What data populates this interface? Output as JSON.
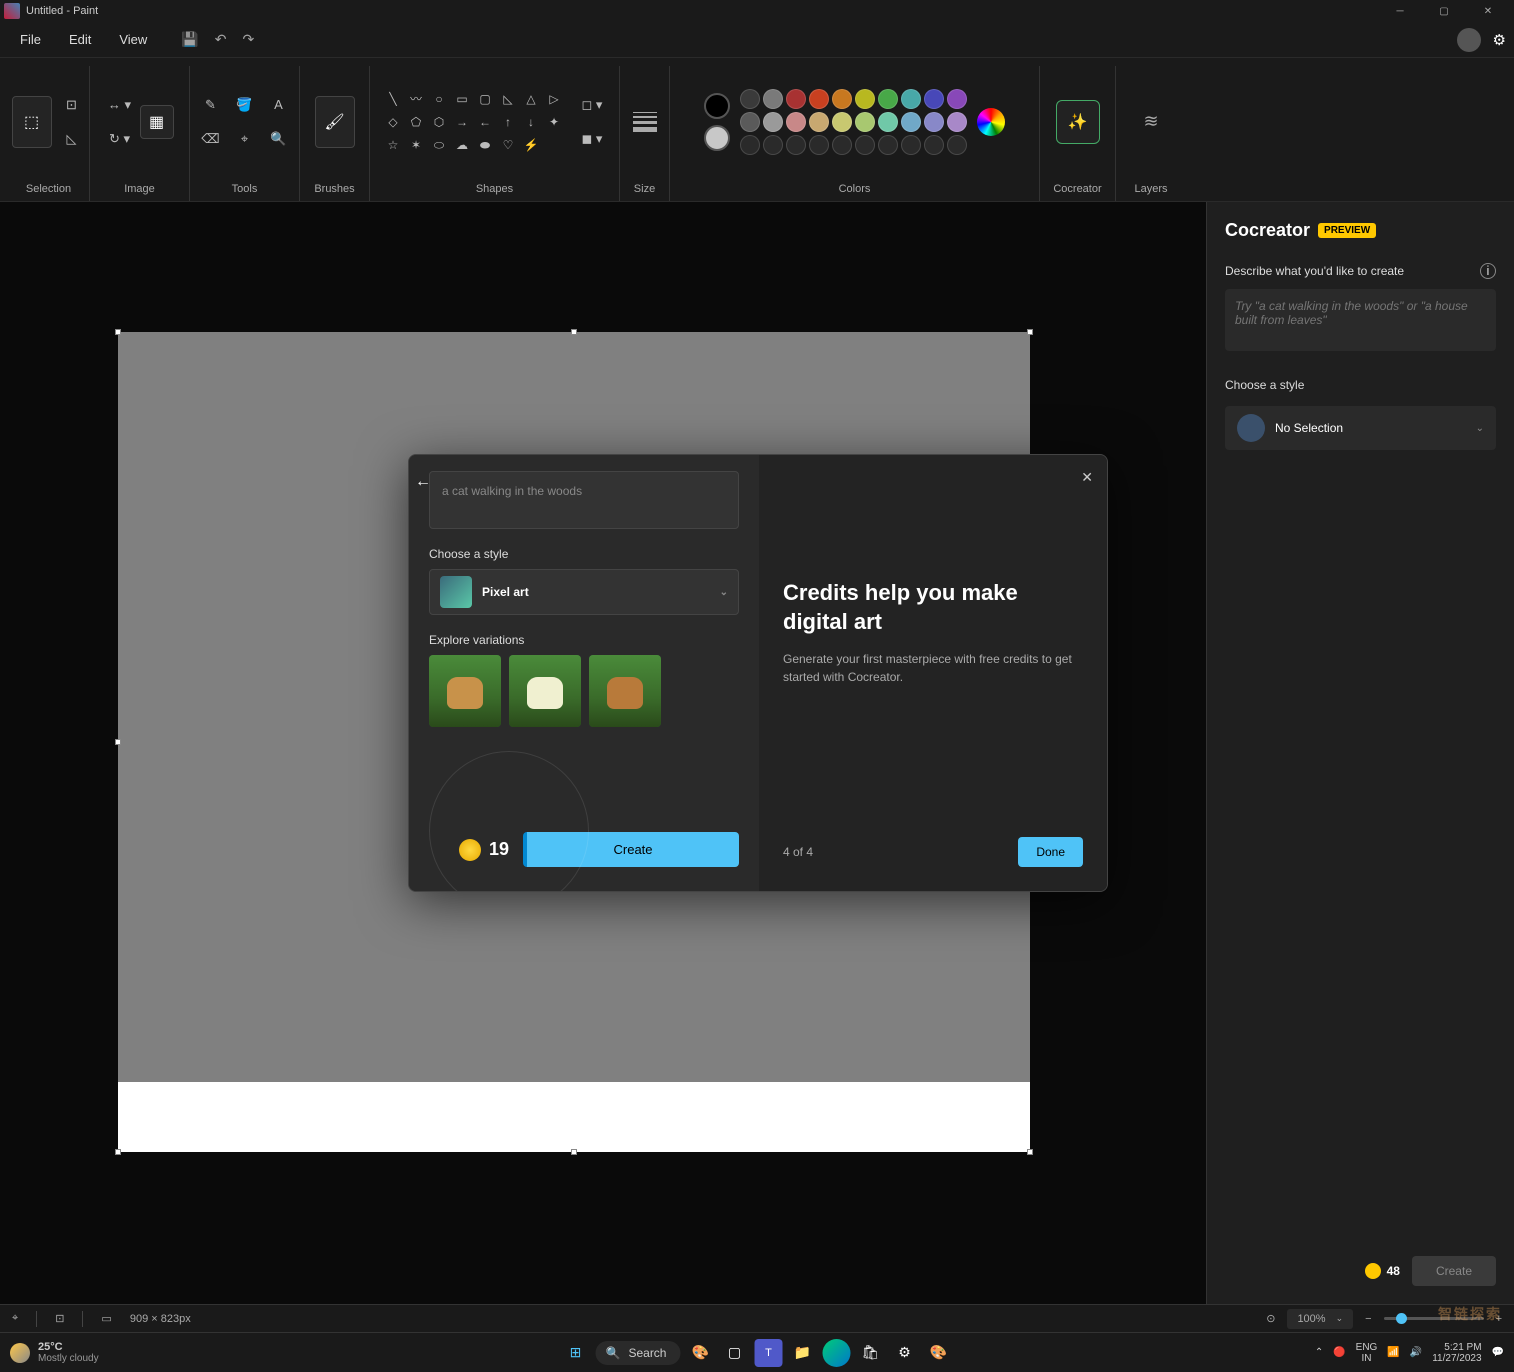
{
  "title": "Untitled - Paint",
  "menus": {
    "file": "File",
    "edit": "Edit",
    "view": "View"
  },
  "ribbon": {
    "selection": "Selection",
    "image": "Image",
    "tools": "Tools",
    "brushes": "Brushes",
    "shapes": "Shapes",
    "size": "Size",
    "colors": "Colors",
    "cocreator": "Cocreator",
    "layers": "Layers"
  },
  "palette_row1": [
    "#3a3a3a",
    "#7a7a7a",
    "#a83232",
    "#c84020",
    "#c87820",
    "#b8b820",
    "#48a848",
    "#48a8a8",
    "#4848b8",
    "#8848b8"
  ],
  "palette_row2": [
    "#5a5a5a",
    "#9a9a9a",
    "#c88888",
    "#c8a870",
    "#c8c870",
    "#a8c870",
    "#70c8a8",
    "#70a8c8",
    "#8888c8",
    "#a888c8"
  ],
  "palette_row3": [
    "#2a2a2a",
    "#2a2a2a",
    "#2a2a2a",
    "#2a2a2a",
    "#2a2a2a",
    "#2a2a2a",
    "#2a2a2a",
    "#2a2a2a",
    "#2a2a2a",
    "#2a2a2a"
  ],
  "cur_color1": "#000000",
  "cur_color2": "#c8c8c8",
  "side": {
    "title": "Cocreator",
    "badge": "PREVIEW",
    "describe": "Describe what you'd like to create",
    "placeholder": "Try \"a cat walking in the woods\" or \"a house built from leaves\"",
    "choose": "Choose a style",
    "no_selection": "No Selection",
    "credits": "48",
    "create": "Create"
  },
  "modal": {
    "input": "a cat walking in the woods",
    "choose": "Choose a style",
    "style": "Pixel art",
    "explore": "Explore variations",
    "credits": "19",
    "create": "Create",
    "right_title": "Credits help you make digital art",
    "right_sub": "Generate your first masterpiece with free credits to get started with Cocreator.",
    "step": "4 of 4",
    "done": "Done"
  },
  "status": {
    "dims": "909 × 823px",
    "zoom": "100%"
  },
  "taskbar": {
    "temp": "25°C",
    "cond": "Mostly cloudy",
    "search": "Search",
    "lang1": "ENG",
    "lang2": "IN",
    "time": "5:21 PM",
    "date": "11/27/2023"
  },
  "watermark": "智链探索"
}
